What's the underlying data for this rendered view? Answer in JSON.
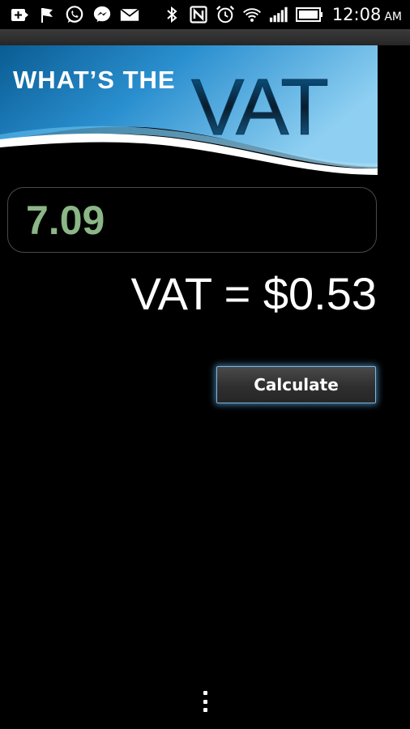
{
  "status_bar": {
    "time": "12:08",
    "ampm": "AM",
    "icons": [
      "add-notification-icon",
      "flag-icon",
      "whatsapp-icon",
      "messenger-icon",
      "mail-icon",
      "bluetooth-icon",
      "nfc-icon",
      "alarm-icon",
      "wifi-icon",
      "signal-icon",
      "battery-icon"
    ]
  },
  "banner": {
    "line1": "WHAT’S THE",
    "line2": "VAT"
  },
  "amount_input": {
    "value": "7.09"
  },
  "result": {
    "text": "VAT = $0.53"
  },
  "calculate_button": {
    "label": "Calculate"
  },
  "colors": {
    "input_text": "#8bb686",
    "button_glow": "#5aaae6",
    "banner_blue": "#0f6ea8"
  }
}
